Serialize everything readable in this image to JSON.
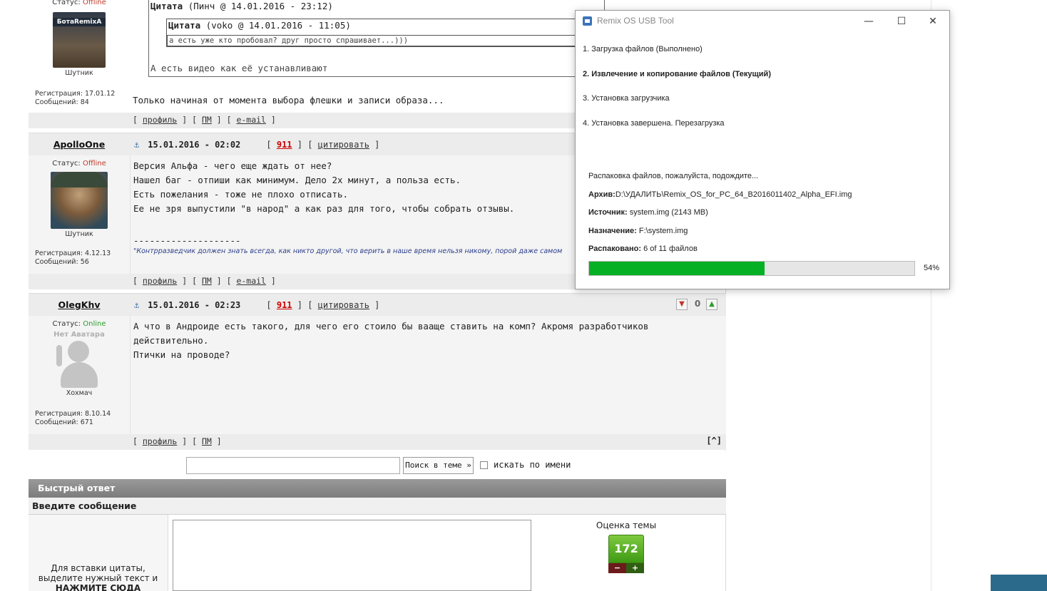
{
  "forum": {
    "first_post": {
      "status_label": "Статус:",
      "status_value": "Offline",
      "avatar_text": "БотаRemixA",
      "role": "Шутник",
      "reg_label": "Регистрация:",
      "reg_value": "17.01.12",
      "msg_label": "Сообщений:",
      "msg_value": "84",
      "quote_outer_label": "Цитата",
      "quote_outer_meta": "(Пинч @ 14.01.2016 - 23:12)",
      "quote_inner_label": "Цитата",
      "quote_inner_meta": "(voko @ 14.01.2016 - 11:05)",
      "quote_inner_text": "а есть уже кто пробовал? друг просто спрашивает...)))",
      "quote_outer_text": "А есть видео как её устанавливают",
      "text": "Только начиная от момента выбора флешки и записи образа...",
      "links": [
        "профиль",
        "ПМ",
        "e-mail"
      ]
    },
    "posts": [
      {
        "author": "ApolloOne",
        "date": "15.01.2016 - 02:02",
        "num": "911",
        "quote_link": "цитировать",
        "status_label": "Статус:",
        "status_value": "Offline",
        "role": "Шутник",
        "reg_label": "Регистрация:",
        "reg_value": "4.12.13",
        "msg_label": "Сообщений:",
        "msg_value": "56",
        "lines": [
          "Версия Альфа - чего еще ждать от нее?",
          "Нашел баг - отпиши как минимум. Дело 2х минут, а польза есть.",
          "Есть пожелания - тоже не плохо отписать.",
          "Ее не зря выпустили \"в народ\" а как раз для того, чтобы собрать отзывы."
        ],
        "signature_sep": "--------------------",
        "signature": "\"Контрразведчик должен знать всегда, как никто другой, что верить в наше время нельзя никому, порой даже самом",
        "links": [
          "профиль",
          "ПМ",
          "e-mail"
        ]
      },
      {
        "author": "OlegKhv",
        "date": "15.01.2016 - 02:23",
        "num": "911",
        "quote_link": "цитировать",
        "rating": "0",
        "status_label": "Статус:",
        "status_value": "Online",
        "avatar_text": "Нет Аватара",
        "role": "Хохмач",
        "reg_label": "Регистрация:",
        "reg_value": "8.10.14",
        "msg_label": "Сообщений:",
        "msg_value": "671",
        "lines": [
          "А что в Андроиде есть такого, для чего его стоило бы вааще ставить на комп? Акромя разработчиков действительно.",
          "Птички на проводе?"
        ],
        "links": [
          "профиль",
          "ПМ"
        ],
        "top_link": "[^]"
      }
    ],
    "search": {
      "button": "Поиск в теме »",
      "checkbox_label": "искать по имени"
    },
    "quick_reply": {
      "header": "Быстрый ответ",
      "enter_message": "Введите сообщение",
      "hint_line1": "Для вставки цитаты,",
      "hint_line2": "выделите нужный текст и",
      "hint_line3": "НАЖМИТЕ СЮДА",
      "rating_label": "Оценка темы",
      "rating_value": "172",
      "minus": "−",
      "plus": "+"
    }
  },
  "window": {
    "title": "Remix OS USB Tool",
    "minimize": "—",
    "maximize": "☐",
    "close": "✕",
    "steps": [
      "1. Загрузка файлов (Выполнено)",
      "2. Извлечение и копирование файлов (Текущий)",
      "3. Установка загрузчика",
      "4. Установка завершена. Перезагрузка"
    ],
    "status": "Распаковка файлов, пожалуйста, подождите...",
    "archive_label": "Архив:",
    "archive_value": "D:\\УДАЛИТЬ\\Remix_OS_for_PC_64_B2016011402_Alpha_EFI.img",
    "source_label": "Источник:",
    "source_value": "system.img (2143 MB)",
    "dest_label": "Назначение:",
    "dest_value": "F:\\system.img",
    "unpacked_label": "Распаковано:",
    "unpacked_value": "6 of 11 файлов",
    "progress": 54,
    "progress_text": "54%",
    "accent": "#06b025"
  }
}
